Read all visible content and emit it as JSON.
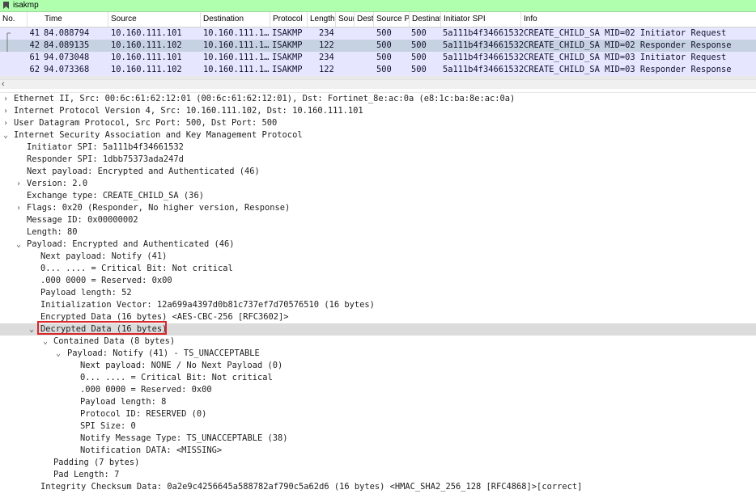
{
  "filter": {
    "text": "isakmp"
  },
  "columns": [
    "No.",
    "Time",
    "Source",
    "Destination",
    "Protocol",
    "Length",
    "Sour",
    "Dest",
    "Source Po",
    "Destinat",
    "Initiator SPI",
    "Info"
  ],
  "packets": [
    {
      "no": "41",
      "time": "84.088794",
      "source": "10.160.111.101",
      "destination": "10.160.111.1…",
      "protocol": "ISAKMP",
      "length": "234",
      "sport": "500",
      "dport": "500",
      "spi": "5a111b4f34661532",
      "info": "CREATE_CHILD_SA MID=02 Initiator Request"
    },
    {
      "no": "42",
      "time": "84.089135",
      "source": "10.160.111.102",
      "destination": "10.160.111.1…",
      "protocol": "ISAKMP",
      "length": "122",
      "sport": "500",
      "dport": "500",
      "spi": "5a111b4f34661532",
      "info": "CREATE_CHILD_SA MID=02 Responder Response"
    },
    {
      "no": "61",
      "time": "94.073048",
      "source": "10.160.111.101",
      "destination": "10.160.111.1…",
      "protocol": "ISAKMP",
      "length": "234",
      "sport": "500",
      "dport": "500",
      "spi": "5a111b4f34661532",
      "info": "CREATE_CHILD_SA MID=03 Initiator Request"
    },
    {
      "no": "62",
      "time": "94.073368",
      "source": "10.160.111.102",
      "destination": "10.160.111.1…",
      "protocol": "ISAKMP",
      "length": "122",
      "sport": "500",
      "dport": "500",
      "spi": "5a111b4f34661532",
      "info": "CREATE_CHILD_SA MID=03 Responder Response"
    }
  ],
  "details": [
    {
      "text": "Ethernet II, Src: 00:6c:61:62:12:01 (00:6c:61:62:12:01), Dst: Fortinet_8e:ac:0a (e8:1c:ba:8e:ac:0a)",
      "toggle": "collapsed"
    },
    {
      "text": "Internet Protocol Version 4, Src: 10.160.111.102, Dst: 10.160.111.101",
      "toggle": "collapsed"
    },
    {
      "text": "User Datagram Protocol, Src Port: 500, Dst Port: 500",
      "toggle": "collapsed"
    },
    {
      "text": "Internet Security Association and Key Management Protocol",
      "toggle": "expanded"
    },
    {
      "text": "Initiator SPI: 5a111b4f34661532",
      "toggle": "none"
    },
    {
      "text": "Responder SPI: 1dbb75373ada247d",
      "toggle": "none"
    },
    {
      "text": "Next payload: Encrypted and Authenticated (46)",
      "toggle": "none"
    },
    {
      "text": "Version: 2.0",
      "toggle": "collapsed"
    },
    {
      "text": "Exchange type: CREATE_CHILD_SA (36)",
      "toggle": "none"
    },
    {
      "text": "Flags: 0x20 (Responder, No higher version, Response)",
      "toggle": "collapsed"
    },
    {
      "text": "Message ID: 0x00000002",
      "toggle": "none"
    },
    {
      "text": "Length: 80",
      "toggle": "none"
    },
    {
      "text": "Payload: Encrypted and Authenticated (46)",
      "toggle": "expanded"
    },
    {
      "text": "Next payload: Notify (41)",
      "toggle": "none"
    },
    {
      "text": "0... .... = Critical Bit: Not critical",
      "toggle": "none"
    },
    {
      "text": ".000 0000 = Reserved: 0x00",
      "toggle": "none"
    },
    {
      "text": "Payload length: 52",
      "toggle": "none"
    },
    {
      "text": "Initialization Vector: 12a699a4397d0b81c737ef7d70576510 (16 bytes)",
      "toggle": "none"
    },
    {
      "text": "Encrypted Data (16 bytes) <AES-CBC-256 [RFC3602]>",
      "toggle": "none"
    },
    {
      "text": "Decrypted Data (16 bytes)",
      "toggle": "expanded"
    },
    {
      "text": "Contained Data (8 bytes)",
      "toggle": "expanded"
    },
    {
      "text": "Payload: Notify (41) - TS_UNACCEPTABLE",
      "toggle": "expanded"
    },
    {
      "text": "Next payload: NONE / No Next Payload  (0)",
      "toggle": "none"
    },
    {
      "text": "0... .... = Critical Bit: Not critical",
      "toggle": "none"
    },
    {
      "text": ".000 0000 = Reserved: 0x00",
      "toggle": "none"
    },
    {
      "text": "Payload length: 8",
      "toggle": "none"
    },
    {
      "text": "Protocol ID: RESERVED (0)",
      "toggle": "none"
    },
    {
      "text": "SPI Size: 0",
      "toggle": "none"
    },
    {
      "text": "Notify Message Type: TS_UNACCEPTABLE (38)",
      "toggle": "none"
    },
    {
      "text": "Notification DATA: <MISSING>",
      "toggle": "none"
    },
    {
      "text": "Padding (7 bytes)",
      "toggle": "none"
    },
    {
      "text": "Pad Length: 7",
      "toggle": "none"
    },
    {
      "text": "Integrity Checksum Data: 0a2e9c4256645a588782af790c5a62d6 (16 bytes) <HMAC_SHA2_256_128 [RFC4868]>[correct]",
      "toggle": "none"
    }
  ]
}
